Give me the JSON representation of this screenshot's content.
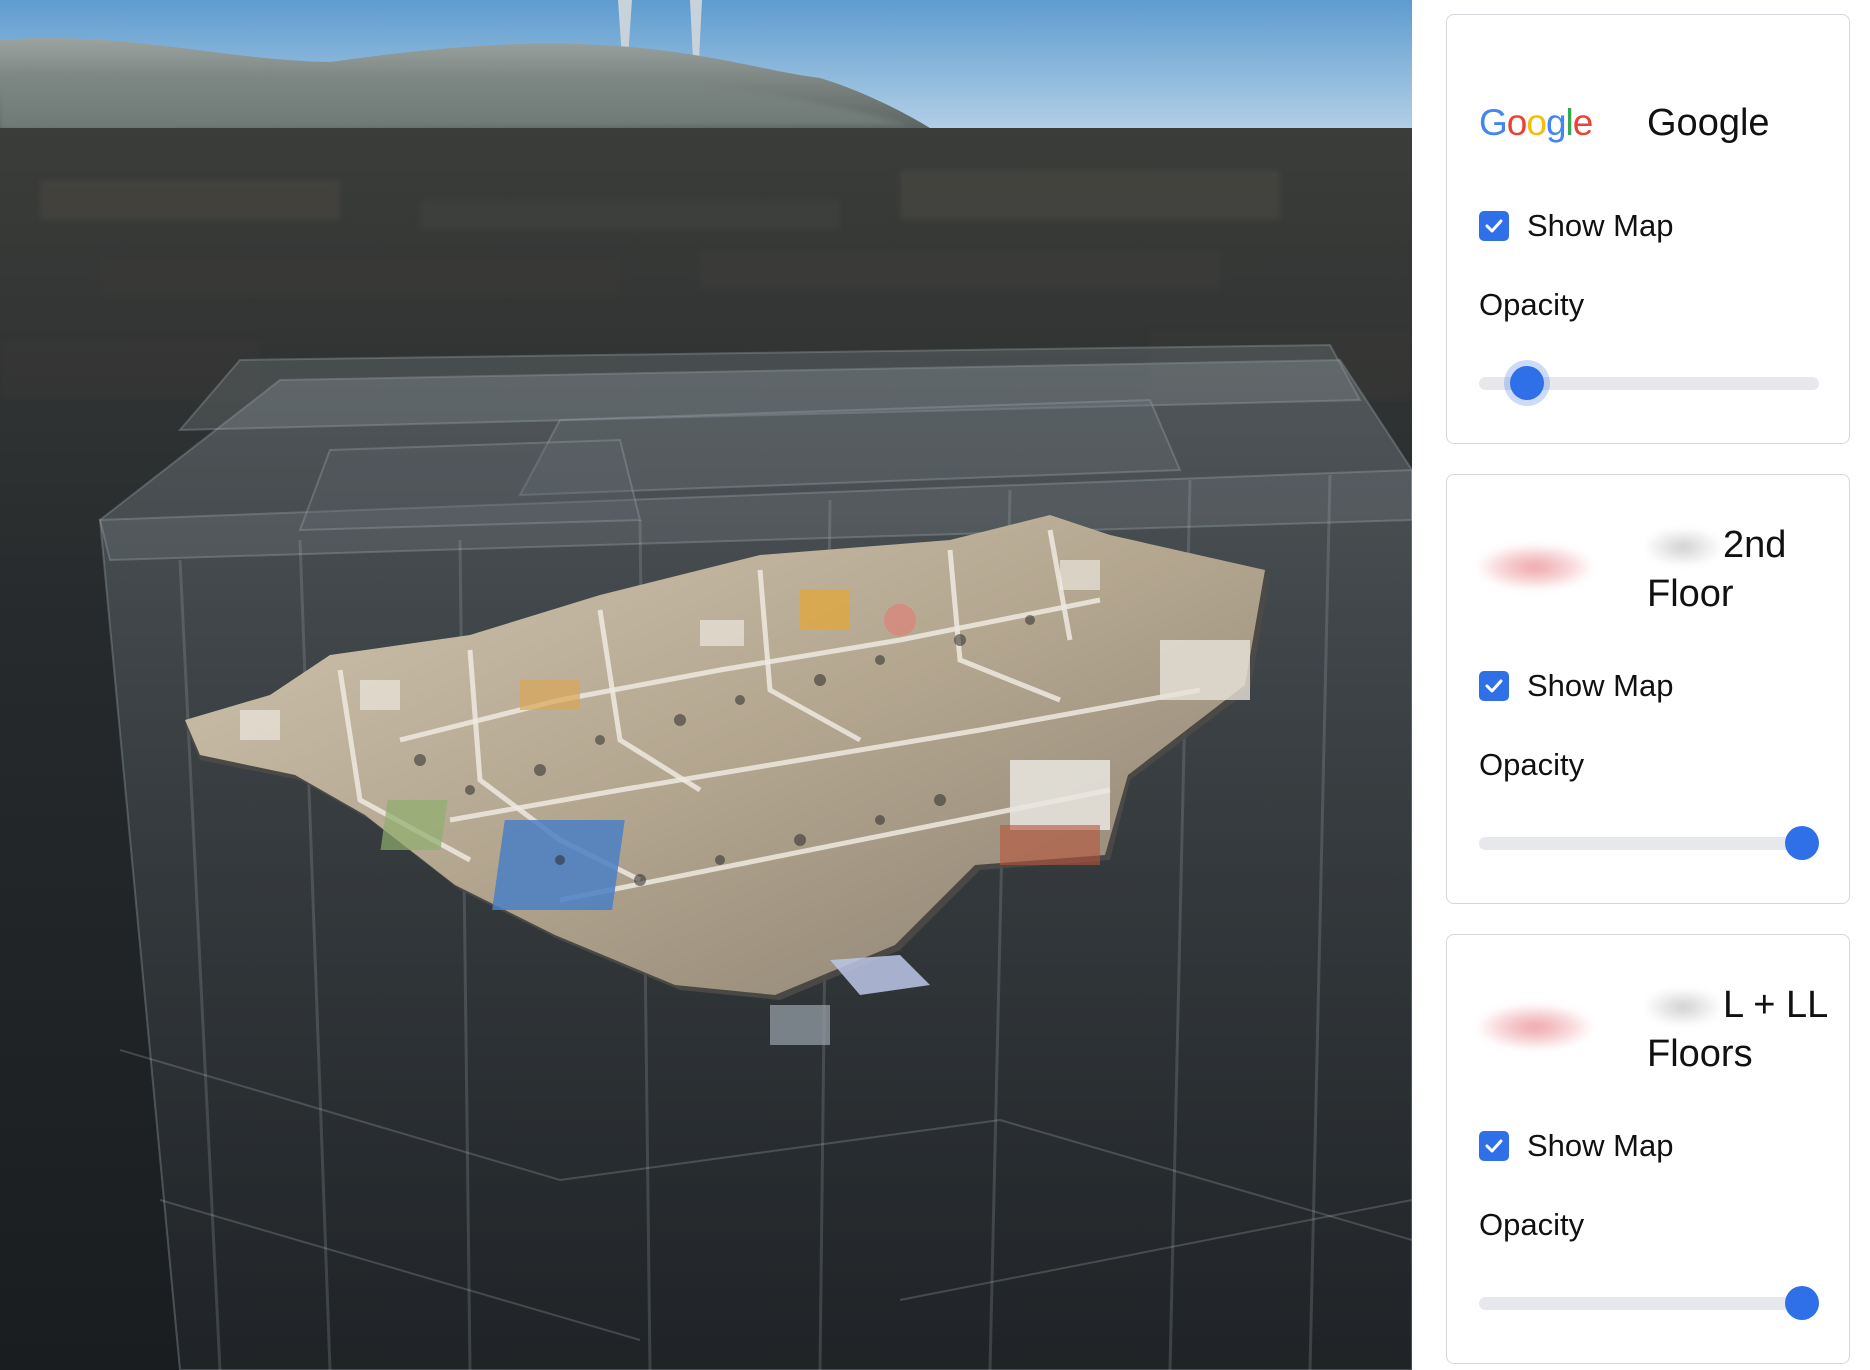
{
  "viewport": {
    "description_icon": "3d-building-model-view"
  },
  "panel": {
    "cards": [
      {
        "logo": "google-logo",
        "logo_letters": [
          "G",
          "o",
          "o",
          "g",
          "l",
          "e"
        ],
        "logo_colors": [
          "#4285F4",
          "#EA4335",
          "#FBBC05",
          "#4285F4",
          "#34A853",
          "#EA4335"
        ],
        "title_redacted": false,
        "title": "Google",
        "show_map_label": "Show Map",
        "show_map_checked": true,
        "opacity_label": "Opacity",
        "opacity_value": 0.14
      },
      {
        "logo": "redacted-logo",
        "title_redacted": true,
        "title": "2nd Floor",
        "show_map_label": "Show Map",
        "show_map_checked": true,
        "opacity_label": "Opacity",
        "opacity_value": 0.95
      },
      {
        "logo": "redacted-logo",
        "title_redacted": true,
        "title": "L + LL Floors",
        "show_map_label": "Show Map",
        "show_map_checked": true,
        "opacity_label": "Opacity",
        "opacity_value": 0.95
      }
    ],
    "accent_color": "#2F6FE8"
  }
}
